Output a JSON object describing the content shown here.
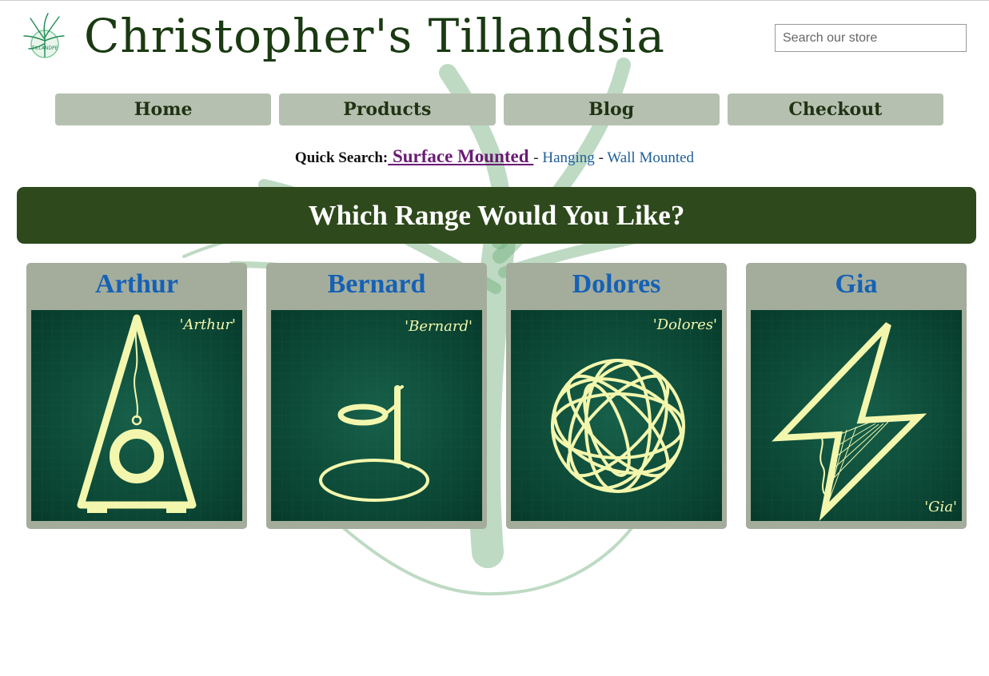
{
  "header": {
    "title": "Christopher's Tillandsia",
    "logo_text": "TILLANDPE",
    "search_placeholder": "Search our store"
  },
  "nav": {
    "items": [
      {
        "label": "Home"
      },
      {
        "label": "Products"
      },
      {
        "label": "Blog"
      },
      {
        "label": "Checkout"
      }
    ]
  },
  "quick_search": {
    "label": "Quick Search:",
    "active": " Surface Mounted ",
    "sep1": "- ",
    "link1": "Hanging",
    "sep2": " - ",
    "link2": "Wall Mounted"
  },
  "banner": {
    "heading": "Which Range Would You Like?"
  },
  "ranges": [
    {
      "name": "Arthur",
      "image_caption": "'Arthur'"
    },
    {
      "name": "Bernard",
      "image_caption": "'Bernard'"
    },
    {
      "name": "Dolores",
      "image_caption": "'Dolores'"
    },
    {
      "name": "Gia",
      "image_caption": "'Gia'"
    }
  ],
  "colors": {
    "title_green": "#1a3a12",
    "nav_bg": "#b6c0b0",
    "banner_bg": "#2e4a1c",
    "card_bg": "#a4ad9c",
    "card_title_blue": "#1561b5",
    "active_link_purple": "#6a1b75",
    "link_blue": "#1f5f9c",
    "drawing_yellow": "#f3f7ad"
  }
}
